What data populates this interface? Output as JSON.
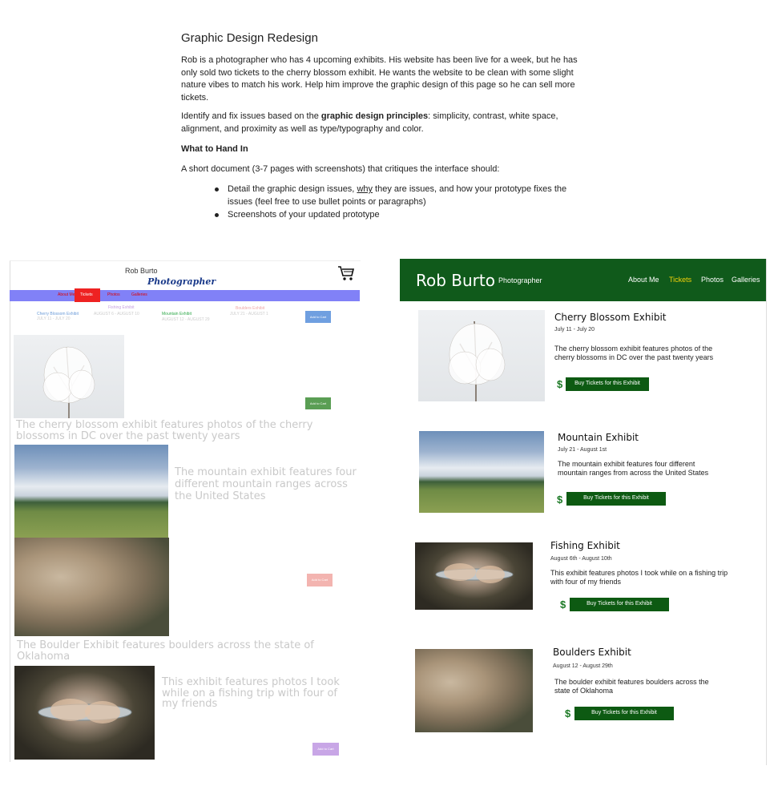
{
  "assignment": {
    "title": "Graphic Design Redesign",
    "para1": "Rob is a photographer who has 4 upcoming exhibits. His website has been live for a week, but he has only sold two tickets to the cherry blossom exhibit. He wants the website to be clean with some slight nature vibes to match his work. Help him improve the graphic design of this page so he can sell more tickets.",
    "para2_a": "Identify and fix issues based on the ",
    "para2_b": "graphic design principles",
    "para2_c": ": simplicity, contrast, white space, alignment, and proximity as well as type/typography and color.",
    "heading": "What to Hand In",
    "para3": "A short document (3-7 pages with screenshots) that critiques the interface should:",
    "bullet1_a": "Detail the graphic design issues, ",
    "bullet1_b": "why",
    "bullet1_c": " they are issues, and how your prototype fixes the issues (feel free to use bullet points or paragraphs)",
    "bullet2": "Screenshots of your updated prototype"
  },
  "old_site": {
    "name": "Rob Burto",
    "tagline": "Photographer",
    "nav": [
      "About Me",
      "Tickets",
      "Photos",
      "Galleries"
    ],
    "exhibits_row": [
      {
        "name": "Cherry Blossom Exhibit",
        "dates": "JULY 11 - JULY 20",
        "color": "#6a9bd8"
      },
      {
        "name": "Fishing Exhibit",
        "dates": "AUGUST 6 - AUGUST 10",
        "color": "#c8a0e0"
      },
      {
        "name": "Mountain Exhibit",
        "dates": "AUGUST 12 - AUGUST 29",
        "color": "#2fa84a"
      },
      {
        "name": "Boulders Exhibit",
        "dates": "JULY 21 - AUGUST 1",
        "color": "#f0a8a8"
      }
    ],
    "add_to_cart": "Add to Cart",
    "cherry_desc": "The cherry blossom exhibit features photos of the cherry blossoms in DC over the past twenty years",
    "mountain_desc": "The mountain exhibit features four different mountain ranges across the United States",
    "boulder_desc": "The Boulder Exhibit features boulders across the state of Oklahoma",
    "fishing_desc": "This exhibit features photos I took while on a fishing trip with four of my friends"
  },
  "new_site": {
    "name": "Rob Burto",
    "tagline": "Photographer",
    "nav": [
      "About Me",
      "Tickets",
      "Photos",
      "Galleries"
    ],
    "accent": "#f4d20a",
    "brand": "#105a1b",
    "buy_label": "Buy Tickets for this Exhibit",
    "currency": "$",
    "exhibits": [
      {
        "title": "Cherry Blossom Exhibit",
        "dates": "July 11 - July 20",
        "desc": "The cherry blossom exhibit features photos of the cherry blossoms in DC over the past twenty years"
      },
      {
        "title": "Mountain Exhibit",
        "dates": "July 21 - August 1st",
        "desc": "The mountain exhibit features four different mountain ranges from across the United States"
      },
      {
        "title": "Fishing Exhibit",
        "dates": "August 6th - August 10th",
        "desc": "This exhibit features photos I took while on a fishing trip with four of my friends"
      },
      {
        "title": "Boulders Exhibit",
        "dates": "August 12 - August 29th",
        "desc": "The boulder exhibit features boulders across the state of Oklahoma"
      }
    ]
  }
}
